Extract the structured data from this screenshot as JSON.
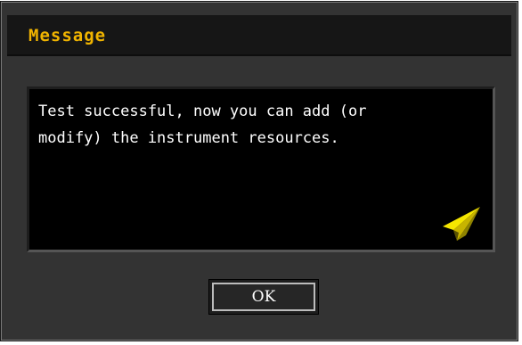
{
  "dialog": {
    "title": "Message",
    "message": "Test successful, now you can add (or\nmodify) the instrument resources.",
    "ok_label": "OK",
    "icon": "paper-plane-icon"
  },
  "colors": {
    "title_text": "#f0b400",
    "dialog_bg": "#333333",
    "message_bg": "#000000",
    "icon_yellow": "#f5e600"
  }
}
